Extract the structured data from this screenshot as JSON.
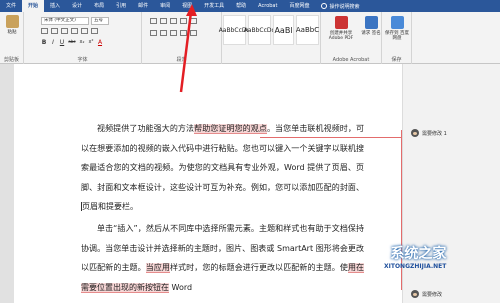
{
  "tabs": [
    "文件",
    "开始",
    "插入",
    "设计",
    "布局",
    "引用",
    "邮件",
    "审阅",
    "视图",
    "开发工具",
    "帮助",
    "Acrobat",
    "百度网盘"
  ],
  "help_text": "操作说明搜索",
  "ribbon": {
    "clipboard": {
      "paste": "粘贴",
      "label": "剪贴板"
    },
    "font": {
      "name": "宋体 (中文正文)",
      "size": "五号",
      "label": "字体",
      "format": [
        "B",
        "I",
        "U",
        "abc",
        "x₂",
        "x²"
      ]
    },
    "paragraph": {
      "label": "段落"
    },
    "styles": {
      "items": [
        "AaBbCcDd",
        "AaBbCcDd",
        "AaBl",
        "AaBbC"
      ]
    },
    "acrobat": {
      "create": "创建并共享 Adobe PDF",
      "request": "请求 签名",
      "label": "Adobe Acrobat"
    },
    "save": {
      "button": "保存到 百度网盘",
      "label": "保存"
    }
  },
  "document": {
    "p1": [
      "视频提供了功能强大的方法",
      "帮助您证明您的观点",
      "。当您单击联机视频时，可以在想要添加的视频的嵌入代码中进行粘贴。您也可以键入一个关键字以联机搜索最适合您的文档的视频。为使您的文档具有专业外观，Word 提供了页眉、页脚、封面和文本框设计，这些设计可互为补充。例如，您可以添加匹配的封面、",
      "页眉和提要栏。"
    ],
    "p2": [
      "单击“插入”，然后从不同库中选择所需元素。主题和样式也有助于文档保持协调。当您单击设计并选择新的主题时，图片、图表或 SmartArt 图形将会更改以匹配新的主题。",
      "当应用",
      "样式时，您的标题会进行更改以匹配新的主题。使",
      "用在需要位置出现的新按钮在",
      "Word"
    ]
  },
  "comments": [
    {
      "label": "需要修改 1"
    },
    {
      "label": "需要修改"
    }
  ],
  "watermark": {
    "title": "系统之家",
    "url": "XITONGZHIJIA.NET"
  }
}
